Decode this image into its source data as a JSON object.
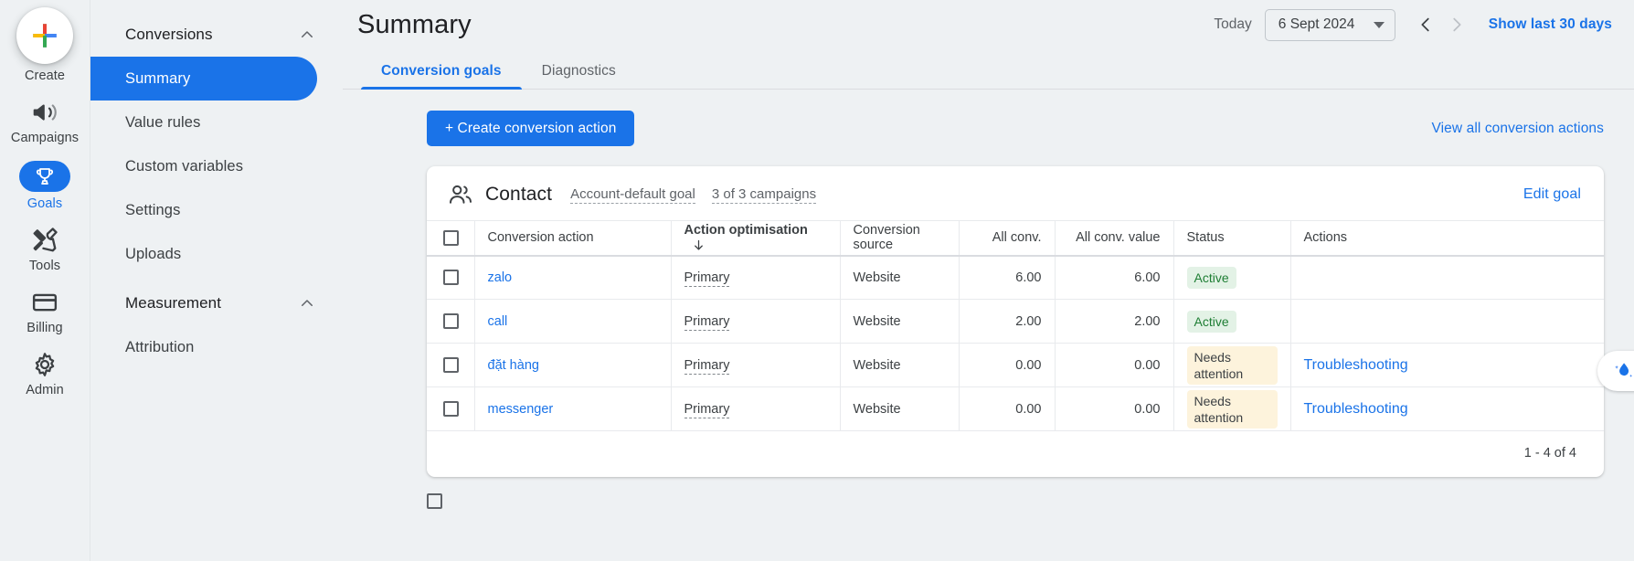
{
  "rail": {
    "items": [
      {
        "label": "Create",
        "icon": "plus-icon",
        "active": false
      },
      {
        "label": "Campaigns",
        "icon": "megaphone-icon",
        "active": false
      },
      {
        "label": "Goals",
        "icon": "trophy-icon",
        "active": true
      },
      {
        "label": "Tools",
        "icon": "tools-icon",
        "active": false
      },
      {
        "label": "Billing",
        "icon": "credit-card-icon",
        "active": false
      },
      {
        "label": "Admin",
        "icon": "gear-icon",
        "active": false
      }
    ]
  },
  "sidebar": {
    "groups": [
      {
        "label": "Conversions",
        "chevron": "chevron-up-icon",
        "items": [
          {
            "label": "Summary",
            "selected": true
          },
          {
            "label": "Value rules",
            "selected": false
          },
          {
            "label": "Custom variables",
            "selected": false
          },
          {
            "label": "Settings",
            "selected": false
          },
          {
            "label": "Uploads",
            "selected": false
          }
        ]
      },
      {
        "label": "Measurement",
        "chevron": "chevron-up-icon",
        "items": [
          {
            "label": "Attribution",
            "selected": false
          }
        ]
      }
    ]
  },
  "header": {
    "title": "Summary",
    "today_label": "Today",
    "date_value": "6 Sept 2024",
    "prev_arrow": "chevron-left-icon",
    "next_arrow": "chevron-right-icon",
    "show_last_30_days": "Show last 30 days"
  },
  "tabs": [
    {
      "label": "Conversion goals",
      "active": true
    },
    {
      "label": "Diagnostics",
      "active": false
    }
  ],
  "actionbar": {
    "create_button": "+ Create conversion action",
    "view_all_link": "View all conversion actions"
  },
  "card": {
    "goal_icon": "people-icon",
    "goal_name": "Contact",
    "chip_default_goal": "Account-default goal",
    "chip_campaigns": "3 of 3 campaigns",
    "edit_goal": "Edit goal",
    "columns": [
      {
        "key": "checkbox",
        "label": "",
        "align": "left",
        "sorted": false
      },
      {
        "key": "conversion_action",
        "label": "Conversion action",
        "align": "left",
        "sorted": false
      },
      {
        "key": "action_optimisation",
        "label": "Action optimisation",
        "align": "left",
        "sorted": true,
        "sort_dir": "down"
      },
      {
        "key": "conversion_source",
        "label": "Conversion source",
        "align": "left",
        "sorted": false
      },
      {
        "key": "all_conv",
        "label": "All conv.",
        "align": "right",
        "sorted": false
      },
      {
        "key": "all_conv_value",
        "label": "All conv. value",
        "align": "right",
        "sorted": false
      },
      {
        "key": "status",
        "label": "Status",
        "align": "left",
        "sorted": false
      },
      {
        "key": "actions",
        "label": "Actions",
        "align": "left",
        "sorted": false
      }
    ],
    "rows": [
      {
        "conversion_action": "zalo",
        "action_optimisation": "Primary",
        "conversion_source": "Website",
        "all_conv": "6.00",
        "all_conv_value": "6.00",
        "status": "Active",
        "status_type": "active",
        "action_link": ""
      },
      {
        "conversion_action": "call",
        "action_optimisation": "Primary",
        "conversion_source": "Website",
        "all_conv": "2.00",
        "all_conv_value": "2.00",
        "status": "Active",
        "status_type": "active",
        "action_link": ""
      },
      {
        "conversion_action": "đặt hàng",
        "action_optimisation": "Primary",
        "conversion_source": "Website",
        "all_conv": "0.00",
        "all_conv_value": "0.00",
        "status": "Needs attention",
        "status_type": "attention",
        "action_link": "Troubleshooting"
      },
      {
        "conversion_action": "messenger",
        "action_optimisation": "Primary",
        "conversion_source": "Website",
        "all_conv": "0.00",
        "all_conv_value": "0.00",
        "status": "Needs attention",
        "status_type": "attention",
        "action_link": "Troubleshooting"
      }
    ],
    "pagination": "1 - 4 of 4"
  },
  "colors": {
    "accent_blue": "#1a73e8",
    "status_active_bg": "#e3f2e6",
    "status_active_text": "#1e7e34",
    "status_attention_bg": "#fdf3dc",
    "page_bg": "#eef1f3"
  }
}
